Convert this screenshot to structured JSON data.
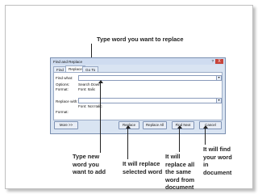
{
  "callouts": {
    "top": "Type word you want to replace",
    "bottom1": [
      "Type new",
      "word you",
      "want to add"
    ],
    "bottom2": [
      "It will replace",
      "selected word"
    ],
    "bottom3": [
      "It will",
      "replace all",
      "the same",
      "word from",
      "document"
    ],
    "bottom4": [
      "It will find",
      "your word",
      "in",
      "document"
    ]
  },
  "dialog": {
    "title": "Find and Replace",
    "help": "?",
    "close": "X",
    "tabs": [
      "Find",
      "Replace",
      "Go To"
    ],
    "find_what_label": "Find what:",
    "find_what_value": "",
    "options_label": "Options:",
    "options_value": "Search Down",
    "format_label": "Format:",
    "format_find_value": "Font: Italic",
    "replace_with_label": "Replace with:",
    "replace_with_value": "",
    "format2_label": "Format:",
    "format_replace_value": "Font: Not Italic",
    "buttons": {
      "more": "More >>",
      "replace": "Replace",
      "replace_all": "Replace All",
      "find_next": "Find Next",
      "cancel": "Cancel"
    }
  },
  "icons": {
    "dropdown": "chevron-down-icon"
  }
}
